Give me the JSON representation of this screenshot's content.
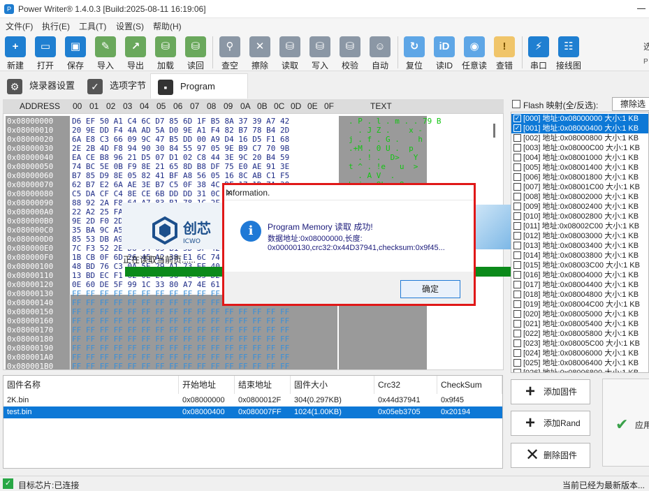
{
  "window": {
    "title": "Power Writer® 1.4.0.3 [Build:2025-08-11 16:19:06]"
  },
  "menu": [
    "文件(F)",
    "执行(E)",
    "工具(T)",
    "设置(S)",
    "帮助(H)"
  ],
  "toolbar": {
    "buttons": [
      {
        "label": "新建",
        "icon": "new-file-icon"
      },
      {
        "label": "打开",
        "icon": "open-folder-icon"
      },
      {
        "label": "保存",
        "icon": "save-icon"
      },
      {
        "label": "导入",
        "icon": "import-icon"
      },
      {
        "label": "导出",
        "icon": "export-icon"
      },
      {
        "label": "加载",
        "icon": "load-icon"
      },
      {
        "label": "读回",
        "icon": "readback-icon"
      },
      {
        "label": "查空",
        "icon": "blank-check-icon"
      },
      {
        "label": "擦除",
        "icon": "erase-icon"
      },
      {
        "label": "读取",
        "icon": "read-icon"
      },
      {
        "label": "写入",
        "icon": "write-icon"
      },
      {
        "label": "校验",
        "icon": "verify-icon"
      },
      {
        "label": "自动",
        "icon": "robot-icon"
      },
      {
        "label": "复位",
        "icon": "reset-icon"
      },
      {
        "label": "读ID",
        "icon": "read-id-icon"
      },
      {
        "label": "任意读",
        "icon": "arbitrary-read-icon"
      },
      {
        "label": "查错",
        "icon": "diagnose-icon"
      },
      {
        "label": "串口",
        "icon": "serial-port-icon"
      },
      {
        "label": "接线图",
        "icon": "wiring-diagram-icon"
      }
    ],
    "edge_text_1": "选",
    "edge_text_2": "P"
  },
  "tabs": [
    {
      "label": "烧录器设置",
      "icon": "gear-icon"
    },
    {
      "label": "选项字节",
      "icon": "options-icon"
    },
    {
      "label": "Program Memory",
      "icon": "memory-chip-icon",
      "active": true
    }
  ],
  "hex": {
    "header": {
      "address": "ADDRESS",
      "cols": [
        "00",
        "01",
        "02",
        "03",
        "04",
        "05",
        "06",
        "07",
        "08",
        "09",
        "0A",
        "0B",
        "0C",
        "0D",
        "0E",
        "0F"
      ],
      "text": "TEXT"
    },
    "rows": [
      {
        "addr": "0x08000000",
        "hex": "D6 EF 50 A1 C4 6C D7 85 6D 1F B5 8A 37 39 A7 42",
        "text": ". P . l . m . . 79 B"
      },
      {
        "addr": "0x08000010",
        "hex": "20 9E DD F4 4A AD 5A D0 9E A1 F4 82 B7 78 B4 2D",
        "text": "  . J Z .    x -"
      },
      {
        "addr": "0x08000020",
        "hex": "6A E8 C3 66 09 9C 47 B5 DD 00 A9 D4 16 D5 F1 68",
        "text": "j . f . G .    h"
      },
      {
        "addr": "0x08000030",
        "hex": "2E 2B 4D F8 94 90 30 84 55 97 05 9E B9 C7 70 9B",
        "text": ".+M . 0 U .  p"
      },
      {
        "addr": "0x08000040",
        "hex": "EA CE B8 96 21 D5 07 D1 02 C8 44 3E 9C 20 B4 59",
        "text": "  . ! .  D>   Y"
      },
      {
        "addr": "0x08000050",
        "hex": "74 BC 5E 0B F9 8E 21 65 8D B8 DF 75 E0 AE 91 3E",
        "text": "t ^ . !e   u  >"
      },
      {
        "addr": "0x08000060",
        "hex": "B7 85 D9 8E 05 82 41 BF A8 56 05 16 8C AB C1 F5",
        "text": "  . A V  ."
      },
      {
        "addr": "0x08000070",
        "hex": "62 B7 E2 6A AE 3E B7 C5 0F 38 4C DE 17 1D 7A 38",
        "text": "b j > 8L  z8"
      },
      {
        "addr": "0x08000080",
        "hex": "C5 DA CF C4 8E CE 6B DD DD 31 0C D2 5D 08 26 42",
        "text": "  k 1 ] &B"
      },
      {
        "addr": "0x08000090",
        "hex": "88 92 2A F8 64 A7 83 B1 78 1C 2F 60 3D 97 14 6E",
        "text": " * d x /`= n"
      },
      {
        "addr": "0x080000A0",
        "hex": "22 A2 25 FA 9B 3C E7 53 AE 42 C7 61 39 B9 E1 1A",
        "text": "\" % < S B a9"
      },
      {
        "addr": "0x080000B0",
        "hex": "9E 2D F0 2D 07 1B 7E 10 91 6E 4A 5B C0 71 73 E2",
        "text": "- - ~ nJ[ qs"
      },
      {
        "addr": "0x080000C0",
        "hex": "35 BA 9C A5 39 C0 A1 D3 8E 7C 2F 56 64 10 E3 AB",
        "text": "5 9 |/Vd"
      },
      {
        "addr": "0x080000D0",
        "hex": "85 53 DB A9 1F 22 76 C7 00 A6 43 EF 51 20 84 0B",
        "text": "S \"v C Q"
      },
      {
        "addr": "0x080000E0",
        "hex": "7C F3 52 2E D8 94 63 B1 5D 3F 42 1A 88 57 6E 0C",
        "text": "| R. c ]?B Wn"
      },
      {
        "addr": "0x080000F0",
        "hex": "1B CB 0F 6D 26 45 A2 38 E1 6C 74 D3 0A 9F 55 C2",
        "text": "m&E 8 lt U"
      },
      {
        "addr": "0x08000100",
        "hex": "48 BD 76 C3 0A 5E 29 A1 73 EE 40 96 2B 11 D4 67",
        "text": "H v ^) s @ + g"
      },
      {
        "addr": "0x08000110",
        "hex": "13 BD EC F1 62 0E 27 96 4C 85 D2 39 A0 7B 18 E5",
        "text": "b ' L 9 {"
      },
      {
        "addr": "0x08000120",
        "hex": "0E 60 DE 5F 99 1C 33 80 A7 4E 61 F2 08 3D 70 B6",
        "text": "`_ 3 Na =p"
      },
      {
        "addr": "0x08000130",
        "hex": "FF FF FF FF FF FF FF FF FF FF FF FF FF FF FF FF",
        "text": ""
      },
      {
        "addr": "0x08000140",
        "hex": "FF FF FF FF FF FF FF FF FF FF FF FF FF FF FF FF",
        "text": ""
      },
      {
        "addr": "0x08000150",
        "hex": "FF FF FF FF FF FF FF FF FF FF FF FF FF FF FF FF",
        "text": ""
      },
      {
        "addr": "0x08000160",
        "hex": "FF FF FF FF FF FF FF FF FF FF FF FF FF FF FF FF",
        "text": ""
      },
      {
        "addr": "0x08000170",
        "hex": "FF FF FF FF FF FF FF FF FF FF FF FF FF FF FF FF",
        "text": ""
      },
      {
        "addr": "0x08000180",
        "hex": "FF FF FF FF FF FF FF FF FF FF FF FF FF FF FF FF",
        "text": ""
      },
      {
        "addr": "0x08000190",
        "hex": "FF FF FF FF FF FF FF FF FF FF FF FF FF FF FF FF",
        "text": ""
      },
      {
        "addr": "0x080001A0",
        "hex": "FF FF FF FF FF FF FF FF FF FF FF FF FF FF FF FF",
        "text": ""
      },
      {
        "addr": "0x080001B0",
        "hex": "FF FF FF FF FF FF FF FF FF FF FF FF FF FF FF FF",
        "text": ""
      }
    ]
  },
  "progress": {
    "text": "正在读取当前页......",
    "logo_text": "创芯",
    "logo_sub": "ICWO",
    "color": "#0b8a1a"
  },
  "flash": {
    "select_all_label": "Flash 映射(全/反选):",
    "erase_button": "擦除选",
    "items": [
      {
        "label": "[000] 地址:0x08000000 大小:1 KB",
        "checked": true,
        "selected": true
      },
      {
        "label": "[001] 地址:0x08000400 大小:1 KB",
        "checked": true,
        "selected": true
      },
      {
        "label": "[002] 地址:0x08000800 大小:1 KB"
      },
      {
        "label": "[003] 地址:0x08000C00 大小:1 KB"
      },
      {
        "label": "[004] 地址:0x08001000 大小:1 KB"
      },
      {
        "label": "[005] 地址:0x08001400 大小:1 KB"
      },
      {
        "label": "[006] 地址:0x08001800 大小:1 KB"
      },
      {
        "label": "[007] 地址:0x08001C00 大小:1 KB"
      },
      {
        "label": "[008] 地址:0x08002000 大小:1 KB"
      },
      {
        "label": "[009] 地址:0x08002400 大小:1 KB"
      },
      {
        "label": "[010] 地址:0x08002800 大小:1 KB"
      },
      {
        "label": "[011] 地址:0x08002C00 大小:1 KB"
      },
      {
        "label": "[012] 地址:0x08003000 大小:1 KB"
      },
      {
        "label": "[013] 地址:0x08003400 大小:1 KB"
      },
      {
        "label": "[014] 地址:0x08003800 大小:1 KB"
      },
      {
        "label": "[015] 地址:0x08003C00 大小:1 KB"
      },
      {
        "label": "[016] 地址:0x08004000 大小:1 KB"
      },
      {
        "label": "[017] 地址:0x08004400 大小:1 KB"
      },
      {
        "label": "[018] 地址:0x08004800 大小:1 KB"
      },
      {
        "label": "[019] 地址:0x08004C00 大小:1 KB"
      },
      {
        "label": "[020] 地址:0x08005000 大小:1 KB"
      },
      {
        "label": "[021] 地址:0x08005400 大小:1 KB"
      },
      {
        "label": "[022] 地址:0x08005800 大小:1 KB"
      },
      {
        "label": "[023] 地址:0x08005C00 大小:1 KB"
      },
      {
        "label": "[024] 地址:0x08006000 大小:1 KB"
      },
      {
        "label": "[025] 地址:0x08006400 大小:1 KB"
      },
      {
        "label": "[026] 地址:0x08006800 大小:1 KB"
      }
    ]
  },
  "firmware": {
    "headers": [
      "固件名称",
      "开始地址",
      "结束地址",
      "固件大小",
      "Crc32",
      "CheckSum"
    ],
    "rows": [
      [
        "2K.bin",
        "0x08000000",
        "0x0800012F",
        "304(0.297KB)",
        "0x44d37941",
        "0x9f45"
      ],
      [
        "test.bin",
        "0x08000400",
        "0x080007FF",
        "1024(1.00KB)",
        "0x05eb3705",
        "0x20194"
      ]
    ]
  },
  "actions": {
    "add_firmware": "添加固件",
    "add_rand": "添加Rand",
    "delete_firmware": "删除固件",
    "apply": "应用"
  },
  "status": {
    "left": "目标芯片:已连接",
    "right": "当前已经为最新版本..."
  },
  "dialog": {
    "title": "Information.",
    "line1": "Program Memory 读取 成功!",
    "line2": "数据地址:0x08000000,长度:",
    "line3": "0x00000130,crc32:0x44D37941,checksum:0x9f45...",
    "ok": "确定",
    "highlight_color": "#e01818"
  }
}
